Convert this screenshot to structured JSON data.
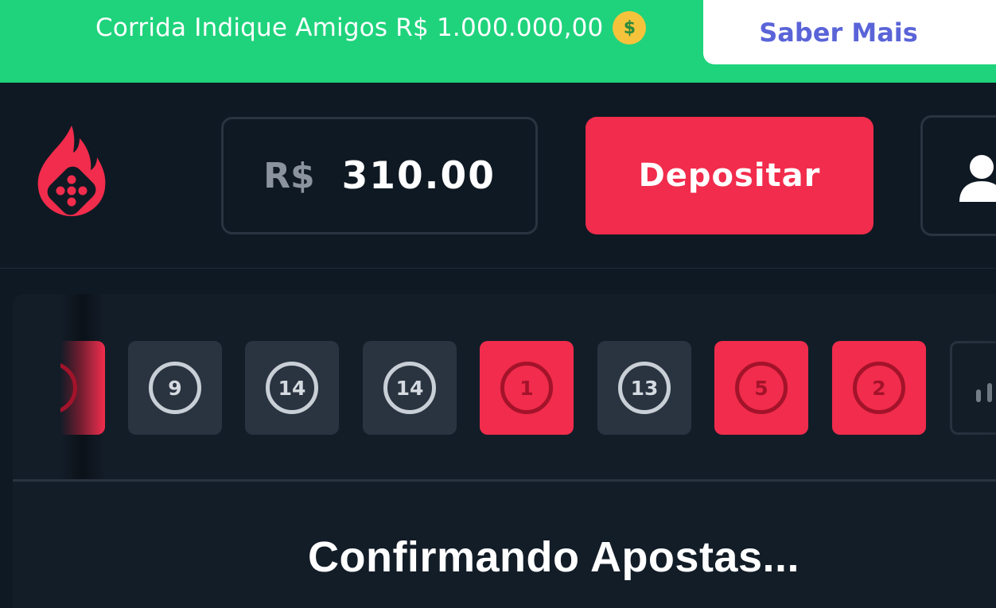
{
  "promo": {
    "text": "Corrida Indique Amigos R$ 1.000.000,00",
    "emoji_icon": "money-mouth-face-icon",
    "cta_label": "Saber Mais"
  },
  "header": {
    "logo_icon": "flaming-dice-logo-icon",
    "balance": {
      "currency": "R$",
      "amount": "310.00"
    },
    "deposit_label": "Depositar",
    "user_icon": "user-icon"
  },
  "history": {
    "tiles": [
      {
        "number": "9",
        "color": "gray"
      },
      {
        "number": "14",
        "color": "gray"
      },
      {
        "number": "14",
        "color": "gray"
      },
      {
        "number": "1",
        "color": "red"
      },
      {
        "number": "13",
        "color": "gray"
      },
      {
        "number": "5",
        "color": "red"
      },
      {
        "number": "2",
        "color": "red"
      }
    ],
    "stats_icon": "bar-chart-icon"
  },
  "status": {
    "text": "Confirmando Apostas..."
  },
  "colors": {
    "promo_green": "#1fd37c",
    "brand_red": "#f12c4c",
    "background": "#0f1923",
    "tile_gray": "#2a3441",
    "link_purple": "#5a64d8"
  }
}
